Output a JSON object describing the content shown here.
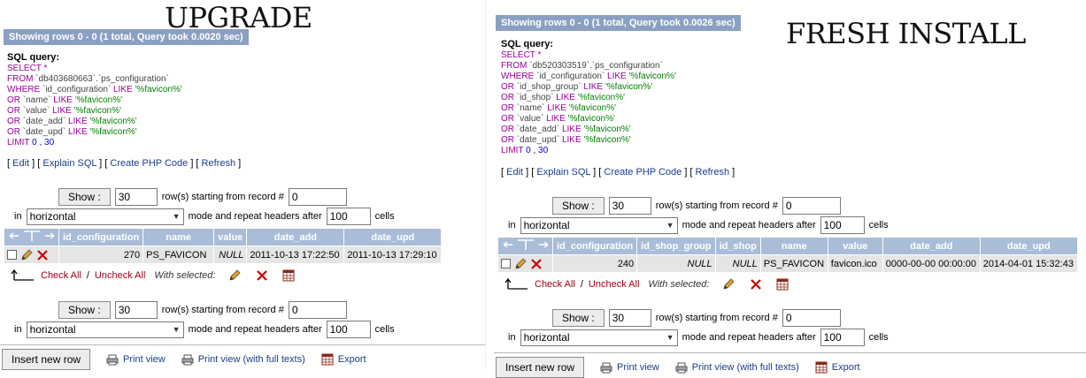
{
  "left": {
    "label": "UPGRADE",
    "status": "Showing rows 0 - 0 (1 total, Query took 0.0020 sec)",
    "sql_label": "SQL query:",
    "sql_lines": [
      {
        "parts": [
          {
            "t": "SELECT",
            "c": "kw"
          },
          {
            "t": " *",
            "c": "kw"
          }
        ]
      },
      {
        "parts": [
          {
            "t": "FROM ",
            "c": "kw"
          },
          {
            "t": "`db403680663`.`ps_configuration`",
            "c": "id"
          }
        ]
      },
      {
        "parts": [
          {
            "t": "WHERE ",
            "c": "kw"
          },
          {
            "t": "`id_configuration` ",
            "c": "id"
          },
          {
            "t": "LIKE ",
            "c": "kw"
          },
          {
            "t": "'%favicon%'",
            "c": "str"
          }
        ]
      },
      {
        "parts": [
          {
            "t": "OR ",
            "c": "kw"
          },
          {
            "t": "`name` ",
            "c": "id"
          },
          {
            "t": "LIKE ",
            "c": "kw"
          },
          {
            "t": "'%favicon%'",
            "c": "str"
          }
        ]
      },
      {
        "parts": [
          {
            "t": "OR ",
            "c": "kw"
          },
          {
            "t": "`value` ",
            "c": "id"
          },
          {
            "t": "LIKE ",
            "c": "kw"
          },
          {
            "t": "'%favicon%'",
            "c": "str"
          }
        ]
      },
      {
        "parts": [
          {
            "t": "OR ",
            "c": "kw"
          },
          {
            "t": "`date_add` ",
            "c": "id"
          },
          {
            "t": "LIKE ",
            "c": "kw"
          },
          {
            "t": "'%favicon%'",
            "c": "str"
          }
        ]
      },
      {
        "parts": [
          {
            "t": "OR ",
            "c": "kw"
          },
          {
            "t": "`date_upd` ",
            "c": "id"
          },
          {
            "t": "LIKE ",
            "c": "kw"
          },
          {
            "t": "'%favicon%'",
            "c": "str"
          }
        ]
      },
      {
        "parts": [
          {
            "t": "LIMIT ",
            "c": "kw"
          },
          {
            "t": "0 , 30",
            "c": "num"
          }
        ]
      }
    ],
    "links": {
      "edit": "Edit",
      "explain": "Explain SQL",
      "create_php": "Create PHP Code",
      "refresh": "Refresh"
    },
    "nav": {
      "show_label": "Show :",
      "rows_value": "30",
      "rows_text": "row(s) starting from record #",
      "start_value": "0",
      "in_text": "in",
      "mode_value": "horizontal",
      "mode_text": "mode and repeat headers after",
      "repeat_value": "100",
      "cells_text": "cells"
    },
    "table": {
      "headers": [
        "id_configuration",
        "name",
        "value",
        "date_add",
        "date_upd"
      ],
      "row": {
        "id_configuration": "270",
        "name": "PS_FAVICON",
        "value": "NULL",
        "date_add": "2011-10-13 17:22:50",
        "date_upd": "2011-10-13 17:29:10"
      }
    },
    "actions": {
      "check_all": "Check All",
      "uncheck_all": "Uncheck All",
      "with_selected": "With selected:"
    },
    "bottom": {
      "insert": "Insert new row",
      "print": "Print view",
      "print_full": "Print view (with full texts)",
      "export": "Export"
    }
  },
  "right": {
    "label": "FRESH INSTALL",
    "status": "Showing rows 0 - 0 (1 total, Query took 0.0026 sec)",
    "sql_label": "SQL query:",
    "sql_lines": [
      {
        "parts": [
          {
            "t": "SELECT",
            "c": "kw"
          },
          {
            "t": " *",
            "c": "kw"
          }
        ]
      },
      {
        "parts": [
          {
            "t": "FROM ",
            "c": "kw"
          },
          {
            "t": "`db520303519`.`ps_configuration`",
            "c": "id"
          }
        ]
      },
      {
        "parts": [
          {
            "t": "WHERE ",
            "c": "kw"
          },
          {
            "t": "`id_configuration` ",
            "c": "id"
          },
          {
            "t": "LIKE ",
            "c": "kw"
          },
          {
            "t": "'%favicon%'",
            "c": "str"
          }
        ]
      },
      {
        "parts": [
          {
            "t": "OR ",
            "c": "kw"
          },
          {
            "t": "`id_shop_group` ",
            "c": "id"
          },
          {
            "t": "LIKE ",
            "c": "kw"
          },
          {
            "t": "'%favicon%'",
            "c": "str"
          }
        ]
      },
      {
        "parts": [
          {
            "t": "OR ",
            "c": "kw"
          },
          {
            "t": "`id_shop` ",
            "c": "id"
          },
          {
            "t": "LIKE ",
            "c": "kw"
          },
          {
            "t": "'%favicon%'",
            "c": "str"
          }
        ]
      },
      {
        "parts": [
          {
            "t": "OR ",
            "c": "kw"
          },
          {
            "t": "`name` ",
            "c": "id"
          },
          {
            "t": "LIKE ",
            "c": "kw"
          },
          {
            "t": "'%favicon%'",
            "c": "str"
          }
        ]
      },
      {
        "parts": [
          {
            "t": "OR ",
            "c": "kw"
          },
          {
            "t": "`value` ",
            "c": "id"
          },
          {
            "t": "LIKE ",
            "c": "kw"
          },
          {
            "t": "'%favicon%'",
            "c": "str"
          }
        ]
      },
      {
        "parts": [
          {
            "t": "OR ",
            "c": "kw"
          },
          {
            "t": "`date_add` ",
            "c": "id"
          },
          {
            "t": "LIKE ",
            "c": "kw"
          },
          {
            "t": "'%favicon%'",
            "c": "str"
          }
        ]
      },
      {
        "parts": [
          {
            "t": "OR ",
            "c": "kw"
          },
          {
            "t": "`date_upd` ",
            "c": "id"
          },
          {
            "t": "LIKE ",
            "c": "kw"
          },
          {
            "t": "'%favicon%'",
            "c": "str"
          }
        ]
      },
      {
        "parts": [
          {
            "t": "LIMIT ",
            "c": "kw"
          },
          {
            "t": "0 , 30",
            "c": "num"
          }
        ]
      }
    ],
    "links": {
      "edit": "Edit",
      "explain": "Explain SQL",
      "create_php": "Create PHP Code",
      "refresh": "Refresh"
    },
    "nav": {
      "show_label": "Show :",
      "rows_value": "30",
      "rows_text": "row(s) starting from record #",
      "start_value": "0",
      "in_text": "in",
      "mode_value": "horizontal",
      "mode_text": "mode and repeat headers after",
      "repeat_value": "100",
      "cells_text": "cells"
    },
    "table": {
      "headers": [
        "id_configuration",
        "id_shop_group",
        "id_shop",
        "name",
        "value",
        "date_add",
        "date_upd"
      ],
      "row": {
        "id_configuration": "240",
        "id_shop_group": "NULL",
        "id_shop": "NULL",
        "name": "PS_FAVICON",
        "value": "favicon.ico",
        "date_add": "0000-00-00 00:00:00",
        "date_upd": "2014-04-01 15:32:43"
      }
    },
    "actions": {
      "check_all": "Check All",
      "uncheck_all": "Uncheck All",
      "with_selected": "With selected:"
    },
    "bottom": {
      "insert": "Insert new row",
      "print": "Print view",
      "print_full": "Print view (with full texts)",
      "export": "Export"
    }
  },
  "icons": {
    "edit": "pencil-icon",
    "delete": "delete-x-icon",
    "export": "export-table-icon",
    "print": "printer-icon",
    "sort": "sort-arrows-icon",
    "arrow": "select-all-arrow-icon"
  },
  "colors": {
    "header_bg": "#a9bcd8",
    "status_bg": "#8aa0c3",
    "cell_bg": "#e5e5e5",
    "keyword": "#990099",
    "string": "#008000",
    "link": "#1a3e8a",
    "action_link": "#a0001a",
    "delete": "#cc0000"
  }
}
